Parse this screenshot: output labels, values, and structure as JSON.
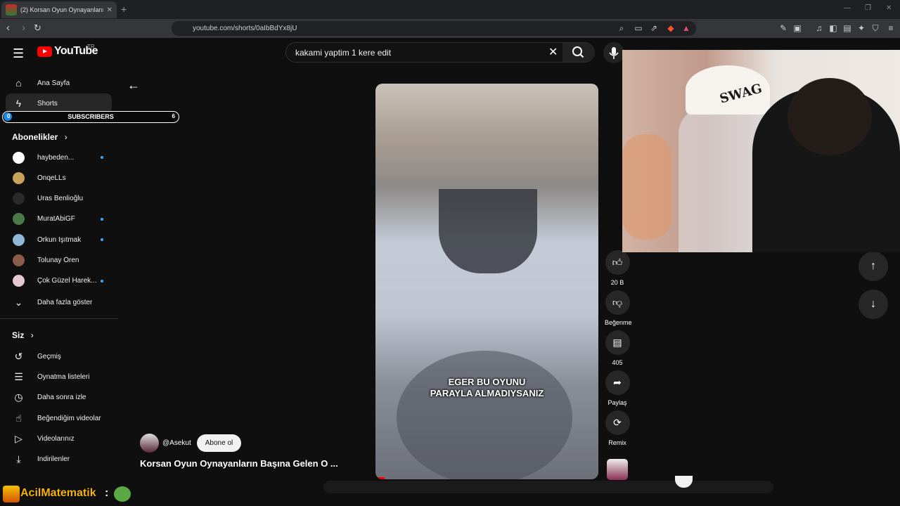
{
  "browser": {
    "tab_title": "(2) Korsan Oyun Oynayanların Başına...",
    "url": "youtube.com/shorts/0aIbBdYx8jU",
    "new_tab_symbol": "+",
    "window_minimize": "—",
    "window_restore": "❐",
    "window_close": "✕"
  },
  "header": {
    "logo_text": "YouTube",
    "region": "TR",
    "search_value": "kakami yaptim 1 kere edit"
  },
  "sidebar": {
    "home": "Ana Sayfa",
    "shorts": "Shorts",
    "subscriptions_heading": "Abonelikler",
    "channels": [
      {
        "name": "haybeden...",
        "color": "#ffffff",
        "live": true
      },
      {
        "name": "OnqeLLs",
        "color": "#c8a15a",
        "live": false
      },
      {
        "name": "Uras Benlioğlu",
        "color": "#2b2b2b",
        "live": false
      },
      {
        "name": "MuratAbiGF",
        "color": "#4a7a4a",
        "live": true
      },
      {
        "name": "Orkun Işıtmak",
        "color": "#8fb8d8",
        "live": true
      },
      {
        "name": "Tolunay Ören",
        "color": "#8a5a4a",
        "live": false
      },
      {
        "name": "Çok Güzel Harek...",
        "color": "#e6c8d0",
        "live": true
      }
    ],
    "show_more": "Daha fazla göster",
    "you_heading": "Siz",
    "you_items": [
      "Geçmiş",
      "Oynatma listeleri",
      "Daha sonra izle",
      "Beğendiğim videolar",
      "Videolarınız",
      "İndirilenler"
    ]
  },
  "subscriber_bar": {
    "label": "SUBSCRIBERS",
    "min": "0",
    "max": "6",
    "progress_fraction": 0.02
  },
  "short": {
    "caption_line1": "EGER BU OYUNU",
    "caption_line2": "PARAYLA ALMADIYSANIZ",
    "channel_handle": "@Asekut",
    "subscribe_label": "Abone ol",
    "title": "Korsan Oyun Oynayanların Başına Gelen O ...",
    "progress_fraction": 0.04
  },
  "actions": {
    "like_count": "20 B",
    "dislike_label": "Beğenme",
    "comment_count": "405",
    "share_label": "Paylaş",
    "remix_label": "Remix"
  },
  "overlay": {
    "streamer_name": "AcilMatematik",
    "separator": ":",
    "cap_text": "SWAG"
  },
  "colors": {
    "accent_red": "#ff0000",
    "live_dot": "#3ea6ff",
    "overlay_name": "#f7b500"
  }
}
